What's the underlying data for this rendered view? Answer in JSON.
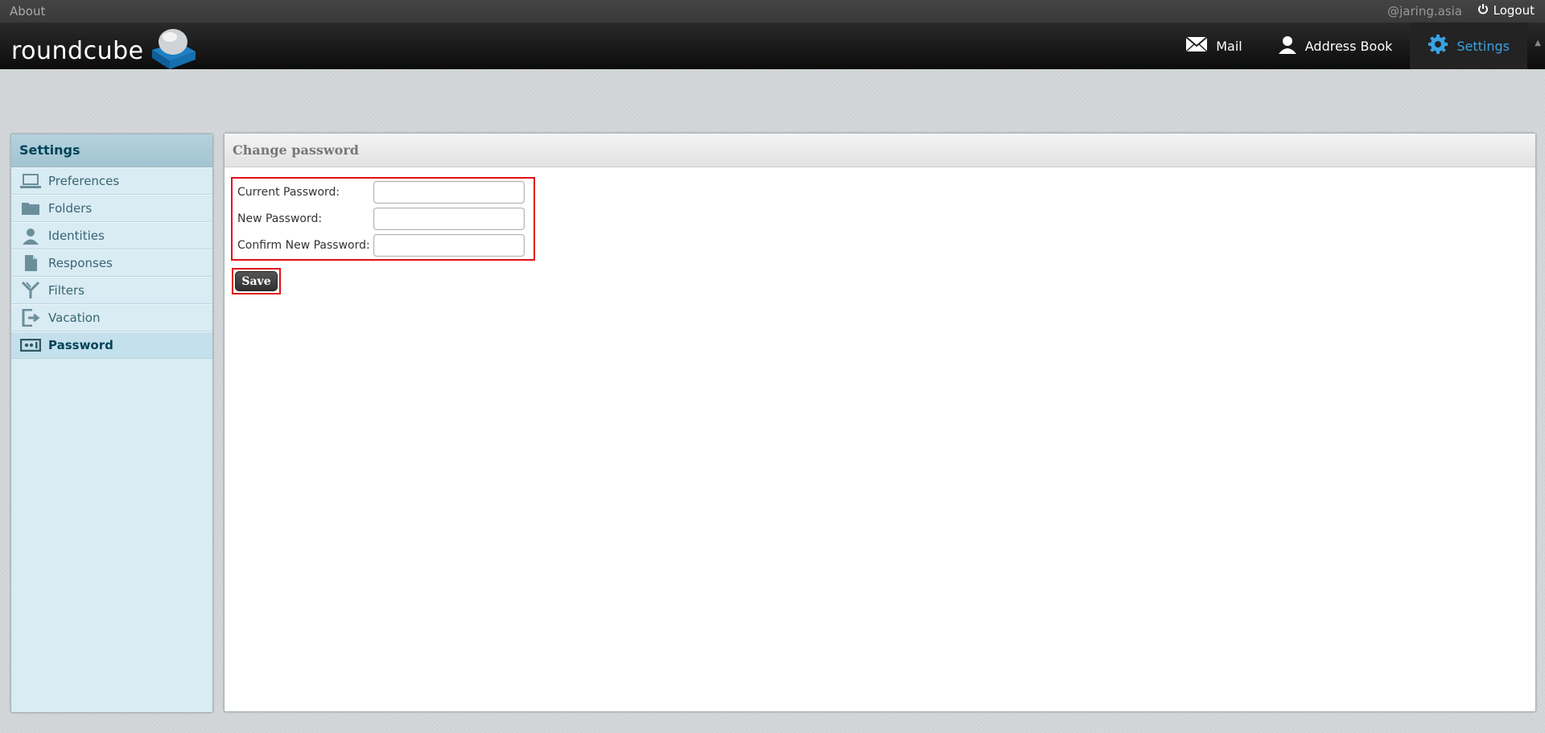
{
  "topline": {
    "about": "About",
    "user": "@jaring.asia",
    "logout": "Logout"
  },
  "header": {
    "logo_text": "roundcube",
    "nav": [
      {
        "label": "Mail",
        "icon": "envelope-icon"
      },
      {
        "label": "Address Book",
        "icon": "person-icon"
      },
      {
        "label": "Settings",
        "icon": "gear-icon",
        "active": true
      }
    ]
  },
  "sidebar": {
    "title": "Settings",
    "items": [
      {
        "label": "Preferences",
        "icon": "laptop-icon"
      },
      {
        "label": "Folders",
        "icon": "folder-icon"
      },
      {
        "label": "Identities",
        "icon": "person-icon"
      },
      {
        "label": "Responses",
        "icon": "document-icon"
      },
      {
        "label": "Filters",
        "icon": "filter-icon"
      },
      {
        "label": "Vacation",
        "icon": "exit-icon"
      },
      {
        "label": "Password",
        "icon": "password-icon",
        "active": true
      }
    ]
  },
  "main": {
    "title": "Change password",
    "fields": [
      {
        "label": "Current Password:",
        "value": ""
      },
      {
        "label": "New Password:",
        "value": ""
      },
      {
        "label": "Confirm New Password:",
        "value": ""
      }
    ],
    "save_label": "Save"
  },
  "colors": {
    "accent": "#3ba2e3",
    "highlight_box": "#e0101a",
    "sidebar_bg": "#d9ebf3"
  }
}
